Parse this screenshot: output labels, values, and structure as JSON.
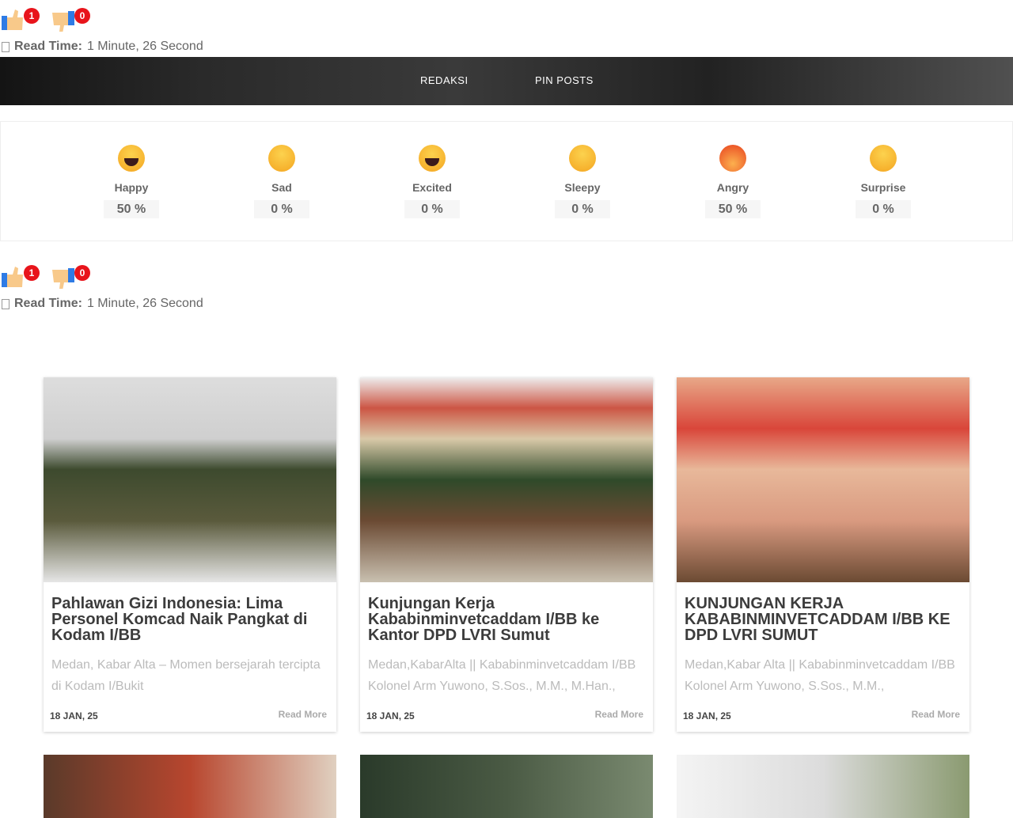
{
  "votes": {
    "like_count": "1",
    "dislike_count": "0"
  },
  "read_time": {
    "label": "Read Time:",
    "value": "1 Minute, 26 Second"
  },
  "nav": {
    "items": [
      "REDAKSI",
      "PIN POSTS"
    ]
  },
  "reactions": [
    {
      "label": "Happy",
      "percent": "50 %"
    },
    {
      "label": "Sad",
      "percent": "0 %"
    },
    {
      "label": "Excited",
      "percent": "0 %"
    },
    {
      "label": "Sleepy",
      "percent": "0 %"
    },
    {
      "label": "Angry",
      "percent": "50 %"
    },
    {
      "label": "Surprise",
      "percent": "0 %"
    }
  ],
  "posts": [
    {
      "title": "Pahlawan Gizi Indonesia: Lima Personel Komcad Naik Pangkat di Kodam I/BB",
      "excerpt": "Medan, Kabar Alta – Momen bersejarah tercipta di Kodam I/Bukit",
      "date": "18 JAN, 25",
      "read_more": "Read More"
    },
    {
      "title": "Kunjungan Kerja Kababinminvetcaddam I/BB ke Kantor DPD LVRI Sumut",
      "excerpt": "Medan,KabarAlta || Kababinminvetcaddam I/BB Kolonel Arm Yuwono, S.Sos., M.M., M.Han.,",
      "date": "18 JAN, 25",
      "read_more": "Read More"
    },
    {
      "title": "KUNJUNGAN KERJA KABABINMINVETCADDAM I/BB KE DPD LVRI SUMUT",
      "excerpt": "Medan,Kabar Alta || Kababinminvetcaddam I/BB Kolonel Arm Yuwono, S.Sos., M.M.,",
      "date": "18 JAN, 25",
      "read_more": "Read More"
    }
  ]
}
